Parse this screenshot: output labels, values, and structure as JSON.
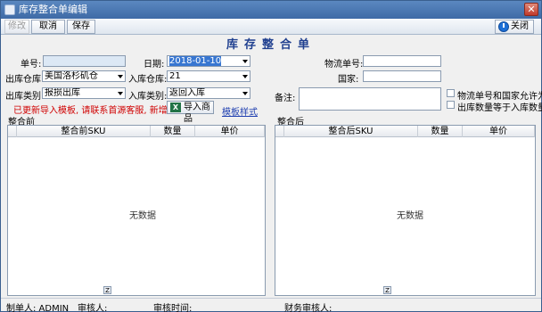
{
  "window": {
    "title": "库存整合单编辑",
    "close_glyph": "✕"
  },
  "toolbar": {
    "modify_label": "修改",
    "cancel_label": "取消",
    "save_label": "保存",
    "close_label": "关闭"
  },
  "form": {
    "title": "库存整合单",
    "order_no": {
      "label": "单号:",
      "value": ""
    },
    "date": {
      "label": "日期:",
      "value": "2018-01-10"
    },
    "logistics_no": {
      "label": "物流单号:",
      "value": ""
    },
    "country": {
      "label": "国家:",
      "value": ""
    },
    "out_warehouse": {
      "label": "出库仓库:",
      "value": "美国洛杉矶仓"
    },
    "in_warehouse": {
      "label": "入库仓库:",
      "value": "21"
    },
    "out_type": {
      "label": "出库类别:",
      "value": "报损出库"
    },
    "in_type": {
      "label": "入库类别:",
      "value": "返回入库"
    },
    "remark": {
      "label": "备注:",
      "value": ""
    },
    "warning": "已更新导入模板, 请联系首源客服, 新增单价导入",
    "import_button": "导入商品",
    "xls_icon": "X",
    "template_link": "模板样式",
    "check_allow_empty": {
      "label": "物流单号和国家允许为空",
      "checked": false
    },
    "check_qty_equal": {
      "label": "出库数量等于入库数量",
      "checked": false
    }
  },
  "before": {
    "section_label": "整合前",
    "columns": [
      "整合前SKU",
      "数量",
      "单价"
    ],
    "rows": [],
    "empty_text": "无数据",
    "footer_btn": "Z"
  },
  "after": {
    "section_label": "整合后",
    "columns": [
      "整合后SKU",
      "数量",
      "单价"
    ],
    "rows": [],
    "empty_text": "无数据",
    "footer_btn": "Z"
  },
  "status": {
    "maker": "制单人: ADMIN",
    "reviewer": "审核人:",
    "review_time": "审核时间:",
    "finance_reviewer": "财务审核人:"
  }
}
